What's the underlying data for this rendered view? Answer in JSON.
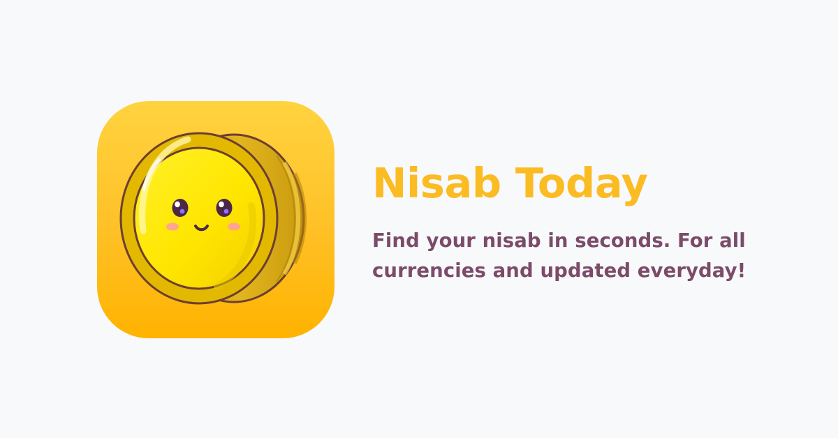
{
  "app": {
    "title": "Nisab Today",
    "tagline": "Find your nisab in seconds. For all currencies and updated everyday!"
  },
  "icons": {
    "app_icon": "smiling-gold-coin-icon"
  },
  "colors": {
    "background": "#f8f9fb",
    "icon_background_top": "#ffd33f",
    "icon_background_bottom": "#ffb300",
    "title": "#fbbb22",
    "tagline": "#7b4b69",
    "coin_face": "#ffe600",
    "coin_rim": "#e2b900",
    "coin_edge": "#c89a0f",
    "coin_outline": "#6d3e32"
  }
}
